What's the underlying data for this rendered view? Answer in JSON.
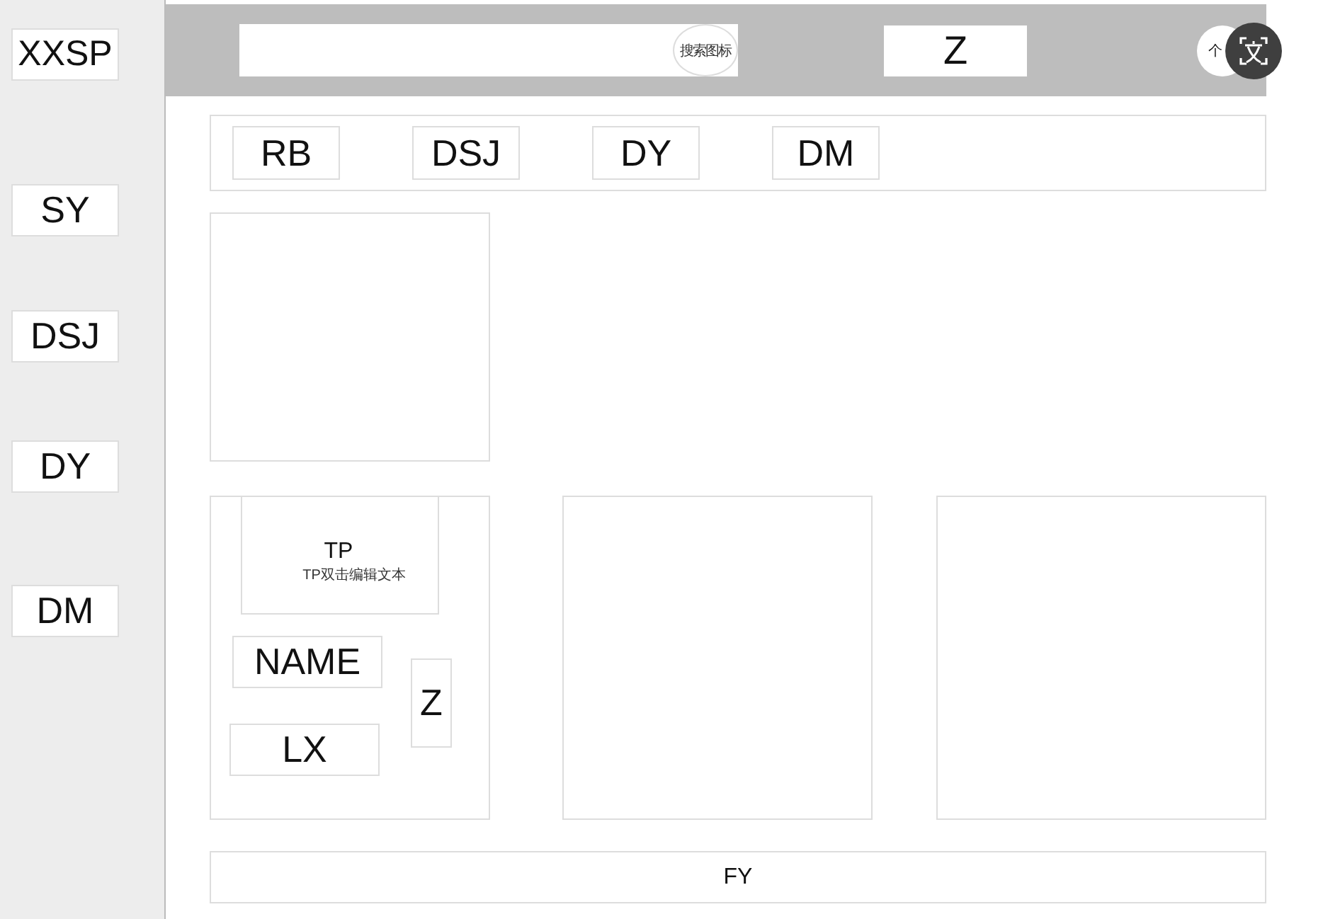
{
  "sidebar": {
    "logo": "XXSP",
    "items": [
      {
        "label": "SY"
      },
      {
        "label": "DSJ"
      },
      {
        "label": "DY"
      },
      {
        "label": "DM"
      }
    ]
  },
  "header": {
    "search_button": "搜索图标",
    "z": "Z",
    "avatar": "个"
  },
  "nav": {
    "items": [
      {
        "label": "RB"
      },
      {
        "label": "DSJ"
      },
      {
        "label": "DY"
      },
      {
        "label": "DM"
      }
    ]
  },
  "card": {
    "image": "TP",
    "hint": "TP双击编辑文本",
    "name": "NAME",
    "type": "LX",
    "z": "Z"
  },
  "footer": "FY"
}
